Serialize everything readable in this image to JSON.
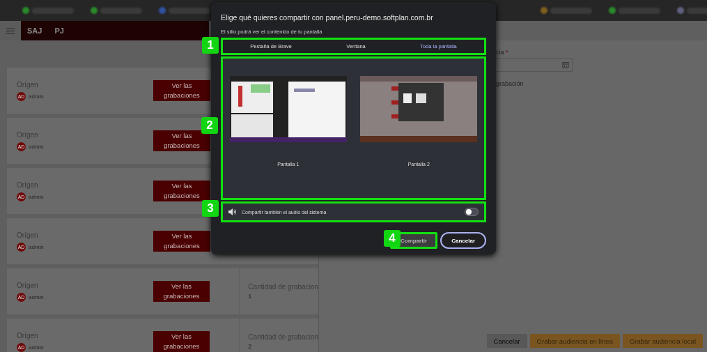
{
  "app_header": {
    "items": [
      "SAJ",
      "PJ"
    ]
  },
  "cards": [
    {
      "title": "Orígen",
      "avatar": "AD",
      "user": "admin",
      "button": "Ver las grabaciones"
    },
    {
      "title": "Orígen",
      "avatar": "AD",
      "user": "admin",
      "button": "Ver las grabaciones"
    },
    {
      "title": "Orígen",
      "avatar": "AD",
      "user": "admin",
      "button": "Ver las grabaciones"
    },
    {
      "title": "Orígen",
      "avatar": "AD",
      "user": "admin",
      "button": "Ver las grabaciones"
    },
    {
      "title": "Orígen",
      "avatar": "AD",
      "user": "admin",
      "button": "Ver las grabaciones",
      "count_label": "Cantidad de grabacion",
      "count": "1"
    },
    {
      "title": "Orígen",
      "avatar": "AD",
      "user": "admin",
      "button": "Ver las grabaciones",
      "count_label": "Cantidad de grabacion",
      "count": "2"
    }
  ],
  "side_panel": {
    "field_label": "cia",
    "required_mark": "*",
    "note": "grabación",
    "buttons": [
      {
        "label": "Cancelar",
        "kind": "secondary"
      },
      {
        "label": "Grabar audiencia en línea",
        "kind": "primary"
      },
      {
        "label": "Grabar audiencia local",
        "kind": "primary"
      }
    ]
  },
  "dialog": {
    "title": "Elige qué quieres compartir con panel.peru-demo.softplan.com.br",
    "subtitle": "El sitio podrá ver el contenido de tu pantalla",
    "tabs": [
      {
        "label": "Pestaña de Brave",
        "selected": false
      },
      {
        "label": "Ventana",
        "selected": false
      },
      {
        "label": "Toda la pantalla",
        "selected": true
      }
    ],
    "sources": [
      {
        "label": "Pantalla 1",
        "kind": "picture"
      },
      {
        "label": "Pantalla 2",
        "kind": "picture"
      }
    ],
    "audio": {
      "label": "Compartir también el audio del sistema",
      "on": false
    },
    "buttons": [
      {
        "label": "Compartir",
        "disabled": true
      },
      {
        "label": "Cancelar",
        "disabled": false
      }
    ]
  },
  "annotations": [
    "1",
    "2",
    "3",
    "4"
  ]
}
